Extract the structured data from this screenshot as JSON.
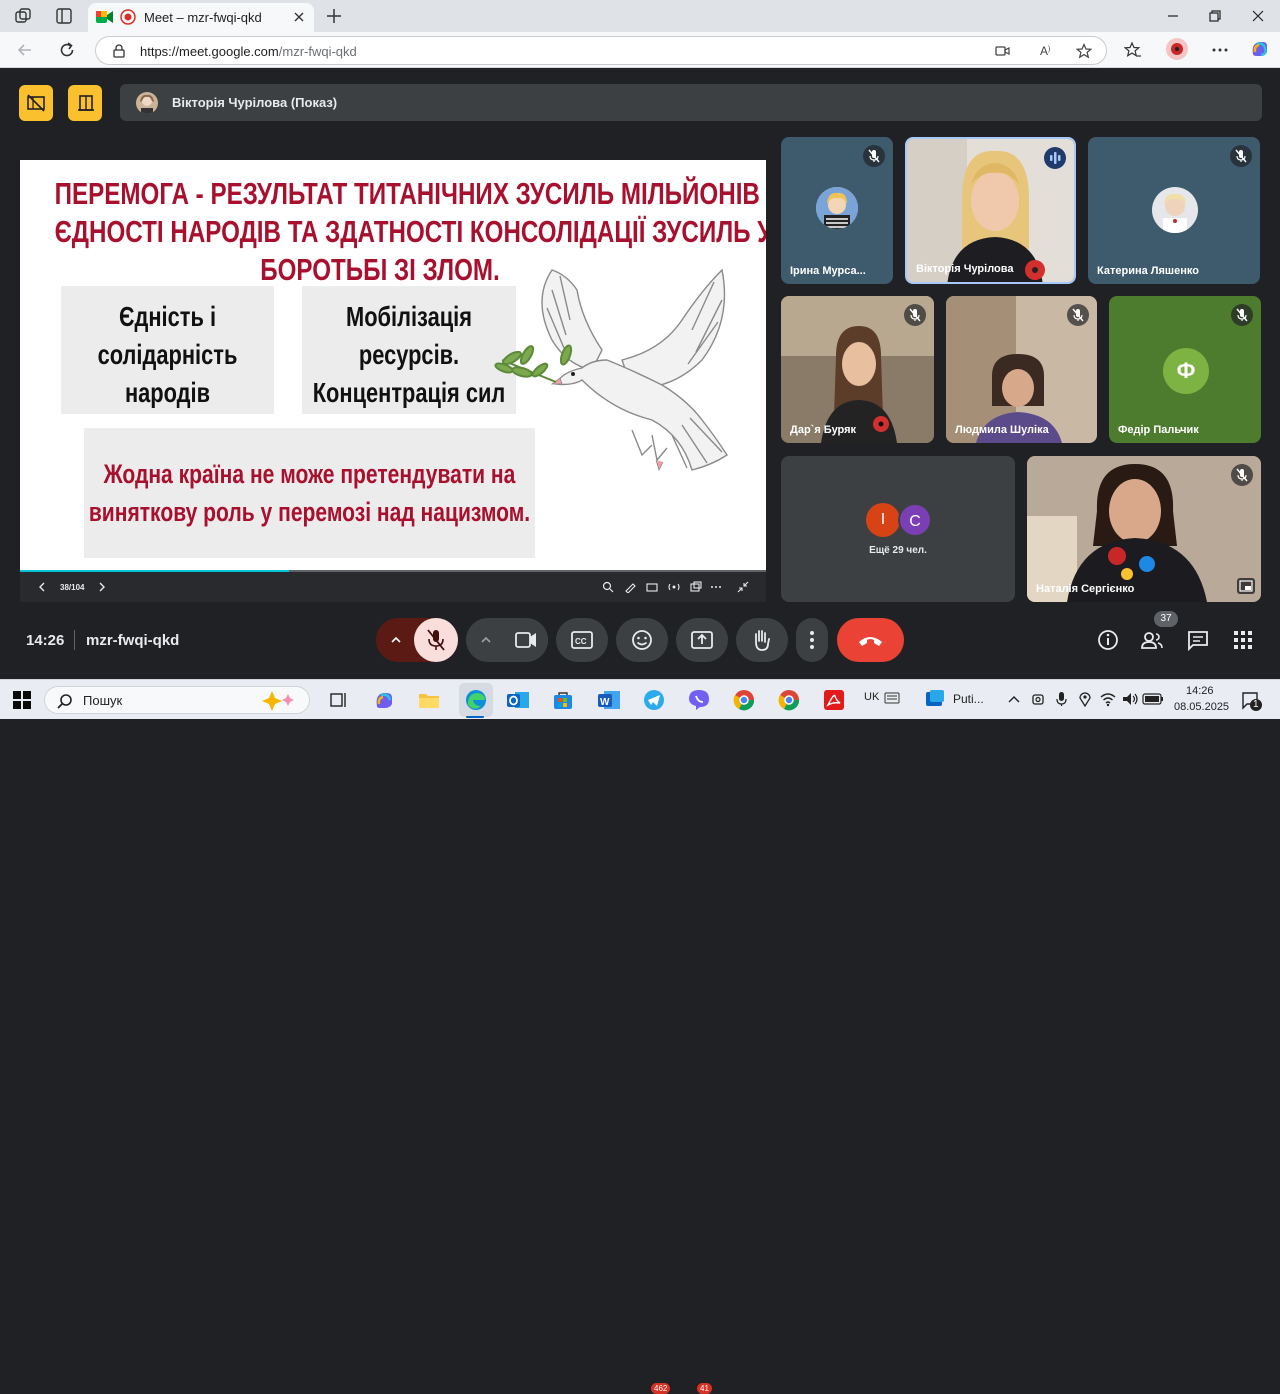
{
  "browser": {
    "tab_title": "Meet – mzr-fwqi-qkd",
    "url_domain": "https://meet.google.com",
    "url_path": "/mzr-fwqi-qkd"
  },
  "meet": {
    "presenter_label": "Вікторія Чурілова (Показ)",
    "slide": {
      "title_line1": "ПЕРЕМОГА - РЕЗУЛЬТАТ ТИТАНІЧНИХ ЗУСИЛЬ МІЛЬЙОНІВ ЛЮДЕЙ.",
      "title_line2": "ЄДНОСТІ НАРОДІВ ТА ЗДАТНОСТІ КОНСОЛІДАЦІЇ ЗУСИЛЬ У",
      "title_line3": "БОРОТЬБІ ЗІ ЗЛОМ.",
      "box1": [
        "Єдність і",
        "солідарність",
        "народів"
      ],
      "box2": [
        "Мобілізація",
        "ресурсів.",
        "Концентрація сил"
      ],
      "box3": [
        "Жодна країна не може претендувати на",
        "виняткову роль у перемозі над нацизмом."
      ],
      "page_counter": "38/104",
      "progress": 0.36
    },
    "participants": [
      {
        "name": "Ірина Мурса...",
        "muted": true
      },
      {
        "name": "Вікторія Чурілова",
        "speaking": true
      },
      {
        "name": "Катерина Ляшенко",
        "muted": true
      },
      {
        "name": "Дар`я Буряк",
        "muted": true
      },
      {
        "name": "Людмила Шуліка",
        "muted": true
      },
      {
        "name": "Федір Пальчик",
        "initial": "Ф",
        "muted": true
      },
      {
        "name": "Наталія Сергієнко",
        "muted": true
      }
    ],
    "others": {
      "initials": [
        "І",
        "С"
      ],
      "label": "Ещё 29 чел."
    },
    "controls": {
      "time": "14:26",
      "meeting_code": "mzr-fwqi-qkd",
      "people_count": "37"
    },
    "colors": {
      "accent_yellow": "#fbc02d",
      "end_call": "#ea4335",
      "mic_off": "#f9dedc",
      "slide_red": "#a8102e"
    }
  },
  "taskbar": {
    "search_label": "Пошук",
    "lang": "UK",
    "putty_label": "Puti...",
    "clock_time": "14:26",
    "clock_date": "08.05.2025",
    "telegram_badge": "462",
    "viber_badge": "41",
    "notif_count": "1"
  }
}
